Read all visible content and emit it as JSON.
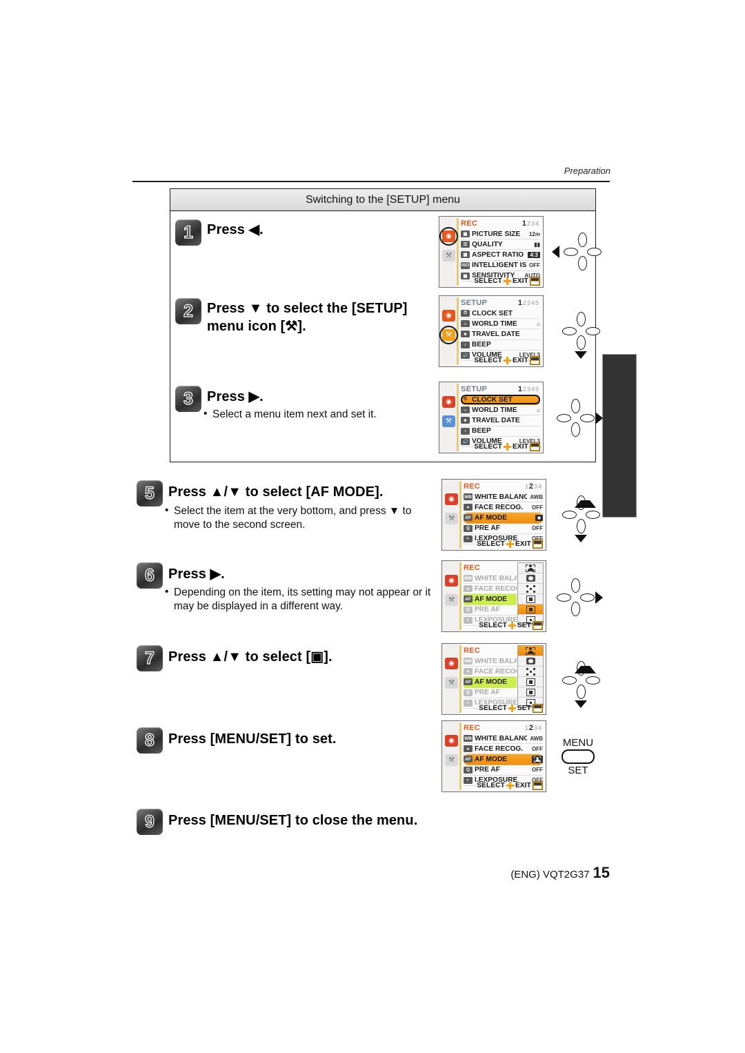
{
  "header": {
    "section_label": "Preparation"
  },
  "boxed_section": {
    "title": "Switching to the [SETUP] menu"
  },
  "steps": [
    {
      "num": "1",
      "text": "Press ◀.",
      "bullets": []
    },
    {
      "num": "2",
      "text": "Press ▼ to select the [SETUP] menu icon [⚒].",
      "bullets": []
    },
    {
      "num": "3",
      "text": "Press ▶.",
      "bullets": [
        "Select a menu item next and set it."
      ]
    },
    {
      "num": "5",
      "text": "Press ▲/▼ to select [AF MODE].",
      "bullets": [
        "Select the item at the very bottom, and press ▼ to move to the second screen."
      ]
    },
    {
      "num": "6",
      "text": "Press ▶.",
      "bullets": [
        "Depending on the item, its setting may not appear or it may be displayed in a different way."
      ]
    },
    {
      "num": "7",
      "text": "Press ▲/▼ to select [▣].",
      "bullets": []
    },
    {
      "num": "8",
      "text": "Press [MENU/SET] to set.",
      "bullets": []
    },
    {
      "num": "9",
      "text": "Press [MENU/SET] to close the menu.",
      "bullets": []
    }
  ],
  "screens": {
    "s1": {
      "title": "REC",
      "pager_active": "1",
      "pager_rest": "234",
      "rows": [
        {
          "icon": "picture-size-icon",
          "label": "PICTURE SIZE",
          "value": "12m"
        },
        {
          "icon": "quality-icon",
          "label": "QUALITY",
          "value": "▮▮"
        },
        {
          "icon": "aspect-ratio-icon",
          "label": "ASPECT RATIO",
          "value": "4:3"
        },
        {
          "icon": "intelligent-iso-icon",
          "label": "INTELLIGENT ISO",
          "value": "OFF"
        },
        {
          "icon": "sensitivity-icon",
          "label": "SENSITIVITY",
          "value": "AUTO"
        }
      ],
      "footer_select": "SELECT",
      "footer_action": "EXIT"
    },
    "s2": {
      "title": "SETUP",
      "pager_active": "1",
      "pager_rest": "2345",
      "rows": [
        {
          "icon": "clock-icon",
          "label": "CLOCK SET",
          "value": ""
        },
        {
          "icon": "world-time-icon",
          "label": "WORLD TIME",
          "value": "⌂"
        },
        {
          "icon": "travel-date-icon",
          "label": "TRAVEL DATE",
          "value": ""
        },
        {
          "icon": "beep-icon",
          "label": "BEEP",
          "value": ""
        },
        {
          "icon": "volume-icon",
          "label": "VOLUME",
          "value": "LEVEL3"
        }
      ],
      "footer_select": "SELECT",
      "footer_action": "EXIT"
    },
    "s3": {
      "title": "SETUP",
      "pager_active": "1",
      "pager_rest": "2345",
      "rows": [
        {
          "icon": "clock-icon",
          "label": "CLOCK SET",
          "value": ""
        },
        {
          "icon": "world-time-icon",
          "label": "WORLD TIME",
          "value": "⌂"
        },
        {
          "icon": "travel-date-icon",
          "label": "TRAVEL DATE",
          "value": ""
        },
        {
          "icon": "beep-icon",
          "label": "BEEP",
          "value": ""
        },
        {
          "icon": "volume-icon",
          "label": "VOLUME",
          "value": "LEVEL3"
        }
      ],
      "footer_select": "SELECT",
      "footer_action": "EXIT"
    },
    "s5": {
      "title": "REC",
      "pager_active": "2",
      "pager_rest": "34",
      "pager_lead": "1",
      "rows": [
        {
          "icon": "white-balance-icon",
          "label": "WHITE BALANCE",
          "value": "AWB"
        },
        {
          "icon": "face-recog-icon",
          "label": "FACE RECOG.",
          "value": "OFF"
        },
        {
          "icon": "af-mode-icon",
          "label": "AF MODE",
          "value": "■"
        },
        {
          "icon": "pre-af-icon",
          "label": "PRE AF",
          "value": "OFF"
        },
        {
          "icon": "i-exposure-icon",
          "label": "I.EXPOSURE",
          "value": "OFF"
        }
      ],
      "footer_select": "SELECT",
      "footer_action": "EXIT"
    },
    "s6": {
      "title": "REC",
      "rows": [
        {
          "icon": "white-balance-icon",
          "label": "WHITE BALANC",
          "value": ""
        },
        {
          "icon": "face-recog-icon",
          "label": "FACE RECOG.",
          "value": ""
        },
        {
          "icon": "af-mode-icon",
          "label": "AF MODE",
          "value": ""
        },
        {
          "icon": "pre-af-icon",
          "label": "PRE AF",
          "value": ""
        },
        {
          "icon": "i-exposure-icon",
          "label": "I.EXPOSURE",
          "value": ""
        }
      ],
      "submenu_selected_index": 4,
      "footer_select": "SELECT",
      "footer_action": "SET"
    },
    "s7": {
      "title": "REC",
      "rows": [
        {
          "icon": "white-balance-icon",
          "label": "WHITE BALANC",
          "value": ""
        },
        {
          "icon": "face-recog-icon",
          "label": "FACE RECOG.",
          "value": ""
        },
        {
          "icon": "af-mode-icon",
          "label": "AF MODE",
          "value": ""
        },
        {
          "icon": "pre-af-icon",
          "label": "PRE AF",
          "value": ""
        },
        {
          "icon": "i-exposure-icon",
          "label": "I.EXPOSURE",
          "value": ""
        }
      ],
      "submenu_selected_index": 0,
      "footer_select": "SELECT",
      "footer_action": "SET"
    },
    "s8": {
      "title": "REC",
      "pager_active": "2",
      "pager_rest": "34",
      "pager_lead": "1",
      "rows": [
        {
          "icon": "white-balance-icon",
          "label": "WHITE BALANCE",
          "value": "AWB"
        },
        {
          "icon": "face-recog-icon",
          "label": "FACE RECOG.",
          "value": "OFF"
        },
        {
          "icon": "af-mode-icon",
          "label": "AF MODE",
          "value": "face"
        },
        {
          "icon": "pre-af-icon",
          "label": "PRE AF",
          "value": "OFF"
        },
        {
          "icon": "i-exposure-icon",
          "label": "I.EXPOSURE",
          "value": "OFF"
        }
      ],
      "footer_select": "SELECT",
      "footer_action": "EXIT"
    }
  },
  "af_submenu_items": [
    "af-face-detection-icon",
    "af-tracking-icon",
    "af-23-area-icon",
    "af-11-area-icon",
    "af-1-area-icon",
    "af-spot-icon"
  ],
  "menu_set_button": {
    "top_label": "MENU",
    "bottom_label": "SET"
  },
  "footer": {
    "code": "(ENG) VQT2G37",
    "page_number": "15"
  }
}
